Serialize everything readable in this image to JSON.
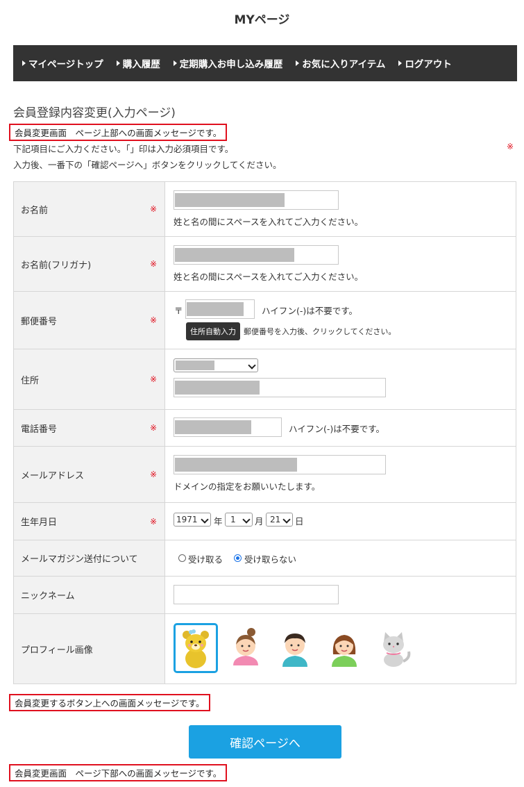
{
  "page": {
    "title": "MYページ"
  },
  "nav": {
    "items": [
      {
        "label": "マイページトップ"
      },
      {
        "label": "購入履歴"
      },
      {
        "label": "定期購入お申し込み履歴"
      },
      {
        "label": "お気に入りアイテム"
      },
      {
        "label": "ログアウト"
      }
    ]
  },
  "section_title": "会員登録内容変更(入力ページ)",
  "messages": {
    "top": "会員変更画面　ページ上部への画面メッセージです。",
    "above_button": "会員変更するボタン上への画面メッセージです。",
    "bottom": "会員変更画面　ページ下部への画面メッセージです。"
  },
  "intro": {
    "line1": "下記項目にご入力ください。「」印は入力必須項目です。",
    "line2": "入力後、一番下の「確認ページへ」ボタンをクリックしてください。",
    "required_mark": "※"
  },
  "fields": {
    "name": {
      "label": "お名前",
      "note": "姓と名の間にスペースを入れてご入力ください。"
    },
    "kana": {
      "label": "お名前(フリガナ)",
      "note": "姓と名の間にスペースを入れてご入力ください。"
    },
    "zip": {
      "label": "郵便番号",
      "prefix": "〒",
      "note": "ハイフン(-)は不要です。",
      "auto_button": "住所自動入力",
      "auto_note": "郵便番号を入力後、クリックしてください。"
    },
    "address": {
      "label": "住所"
    },
    "phone": {
      "label": "電話番号",
      "note": "ハイフン(-)は不要です。"
    },
    "email": {
      "label": "メールアドレス",
      "note": "ドメインの指定をお願いいたします。"
    },
    "birthday": {
      "label": "生年月日",
      "year": "1971",
      "year_unit": "年",
      "month": "1",
      "month_unit": "月",
      "day": "21",
      "day_unit": "日"
    },
    "newsletter": {
      "label": "メールマガジン送付について",
      "option_receive": "受け取る",
      "option_decline": "受け取らない",
      "selected": "受け取らない"
    },
    "nickname": {
      "label": "ニックネーム",
      "value": ""
    },
    "profile_image": {
      "label": "プロフィール画像",
      "options": [
        "bear",
        "girl",
        "boy",
        "woman",
        "cat"
      ],
      "selected": "bear"
    }
  },
  "confirm_button": "確認ページへ",
  "colors": {
    "nav_bg": "#333333",
    "accent": "#1ba1e2",
    "required": "#e0101e",
    "message_border": "#e0101e",
    "label_bg": "#f2f2f2"
  }
}
